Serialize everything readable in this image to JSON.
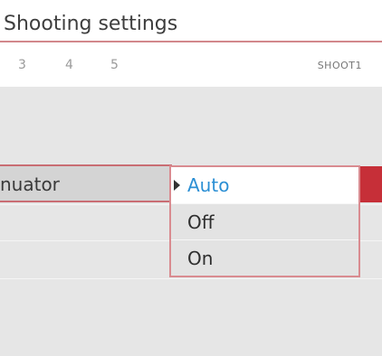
{
  "header": {
    "title": "Shooting settings"
  },
  "tabs": {
    "items": [
      {
        "label": "3"
      },
      {
        "label": "4"
      },
      {
        "label": "5"
      }
    ],
    "page_label": "SHOOT1"
  },
  "menu": {
    "selected_item_label": "nuator"
  },
  "dropdown": {
    "options": [
      {
        "label": "Auto",
        "selected": true
      },
      {
        "label": "Off",
        "selected": false
      },
      {
        "label": "On",
        "selected": false
      }
    ]
  },
  "colors": {
    "accent": "#c62f38",
    "highlight_border": "#d98b90",
    "selected_text": "#2b8fd4"
  }
}
